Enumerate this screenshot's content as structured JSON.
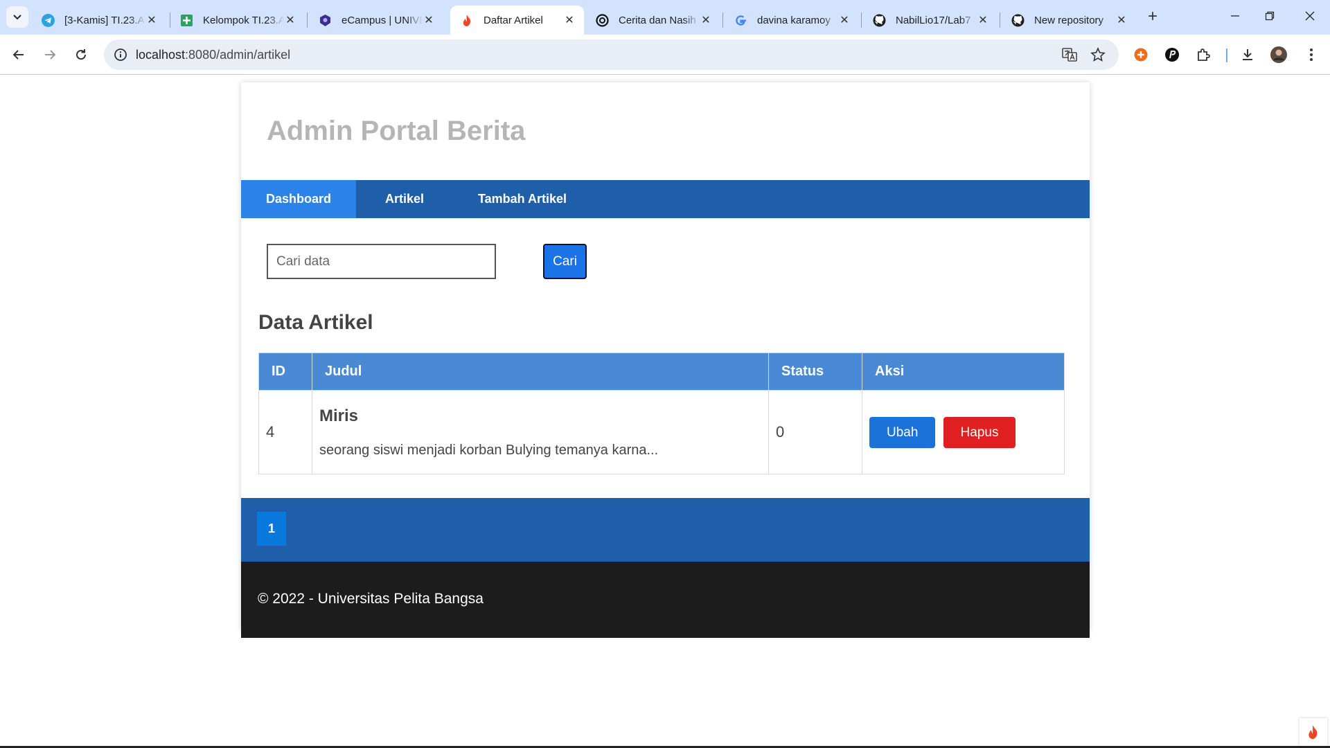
{
  "browser": {
    "tabs": [
      {
        "label": "[3-Kamis] TI.23.A",
        "icon": "telegram-icon"
      },
      {
        "label": "Kelompok TI.23.A",
        "icon": "sheets-icon"
      },
      {
        "label": "eCampus | UNIVE",
        "icon": "campus-icon"
      },
      {
        "label": "Daftar Artikel",
        "icon": "codeigniter-flame-icon"
      },
      {
        "label": "Cerita dan Nasih",
        "icon": "openai-icon"
      },
      {
        "label": "davina karamoy",
        "icon": "google-icon"
      },
      {
        "label": "NabilLio17/Lab7",
        "icon": "github-icon"
      },
      {
        "label": "New repository",
        "icon": "github-icon"
      }
    ],
    "url_host": "localhost",
    "url_path": ":8080/admin/artikel"
  },
  "site": {
    "title": "Admin Portal Berita",
    "nav": [
      "Dashboard",
      "Artikel",
      "Tambah Artikel"
    ]
  },
  "search": {
    "placeholder": "Cari data",
    "button_label": "Cari"
  },
  "section_title": "Data Artikel",
  "table": {
    "headers": [
      "ID",
      "Judul",
      "Status",
      "Aksi"
    ],
    "rows": [
      {
        "id": "4",
        "title": "Miris",
        "excerpt": "seorang siswi menjadi korban Bulying temanya karna...",
        "status": "0",
        "edit_label": "Ubah",
        "delete_label": "Hapus"
      }
    ]
  },
  "pagination": {
    "current": "1"
  },
  "footer": {
    "text": "© 2022 - Universitas Pelita Bangsa"
  },
  "colors": {
    "nav_bg": "#1f5faa",
    "nav_active": "#2b83ea",
    "table_header": "#4a8ad4",
    "btn_blue": "#1a73d9",
    "btn_red": "#e02020",
    "footer_bg": "#1c1c1c"
  }
}
